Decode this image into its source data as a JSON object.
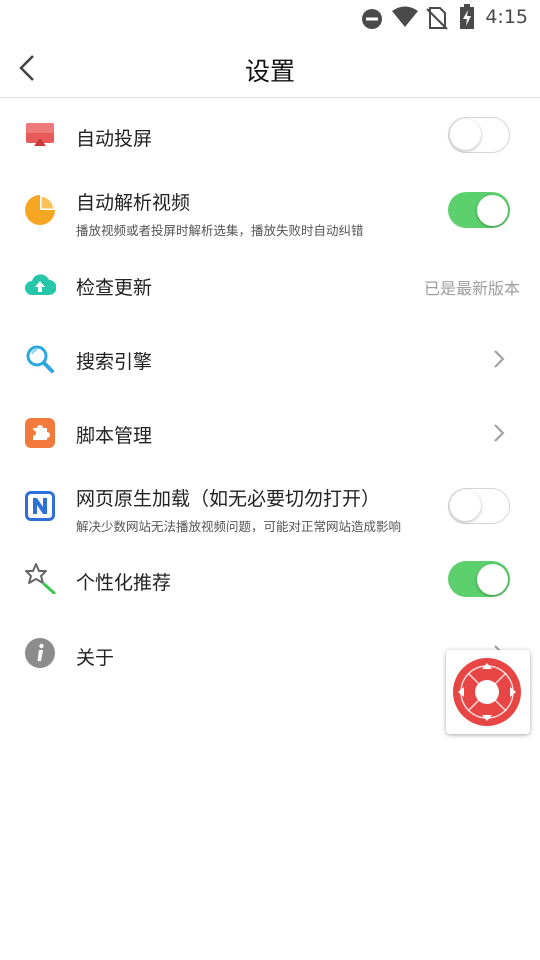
{
  "status_bar": {
    "time": "4:15",
    "icons": [
      "do-not-disturb-icon",
      "wifi-icon",
      "no-sim-icon",
      "battery-charging-icon"
    ]
  },
  "header": {
    "title": "设置",
    "back_icon": "back-arrow-icon"
  },
  "settings": {
    "auto_cast": {
      "label": "自动投屏",
      "icon": "cast-screen-icon",
      "enabled": false
    },
    "auto_parse": {
      "label": "自动解析视频",
      "subtitle": "播放视频或者投屏时解析选集，播放失败时自动纠错",
      "icon": "pie-chart-icon",
      "enabled": true
    },
    "check_update": {
      "label": "检查更新",
      "value": "已是最新版本",
      "icon": "cloud-upload-icon"
    },
    "search_engine": {
      "label": "搜索引擎",
      "icon": "search-icon"
    },
    "script_manage": {
      "label": "脚本管理",
      "icon": "puzzle-icon"
    },
    "native_load": {
      "label": "网页原生加载（如无必要切勿打开）",
      "subtitle": "解决少数网站无法播放视频问题，可能对正常网站造成影响",
      "icon": "n-letter-icon",
      "enabled": false
    },
    "personalized": {
      "label": "个性化推荐",
      "icon": "magic-wand-icon",
      "enabled": true
    },
    "about": {
      "label": "关于",
      "icon": "info-icon"
    }
  },
  "floating_remote": {
    "icon": "remote-dpad-icon"
  },
  "colors": {
    "toggle_on": "#5bd06c",
    "accent_red": "#e84545",
    "orange": "#f5a623",
    "teal": "#26c6a8",
    "blue": "#2f6fd8"
  }
}
